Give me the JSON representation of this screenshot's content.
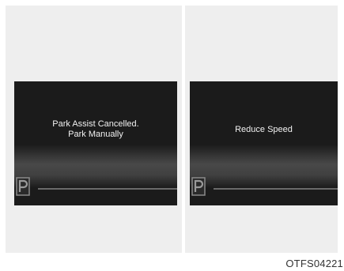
{
  "screens": [
    {
      "lines": [
        "Park Assist Cancelled.",
        "Park Manually"
      ]
    },
    {
      "lines": [
        "Reduce Speed"
      ]
    }
  ],
  "icons": [
    "parking-assist-icon"
  ],
  "caption": "OTFS04221",
  "colors": {
    "panel_bg": "#eeeeee",
    "screen_bg": "#1b1b1b",
    "text": "#f2f2f2"
  }
}
